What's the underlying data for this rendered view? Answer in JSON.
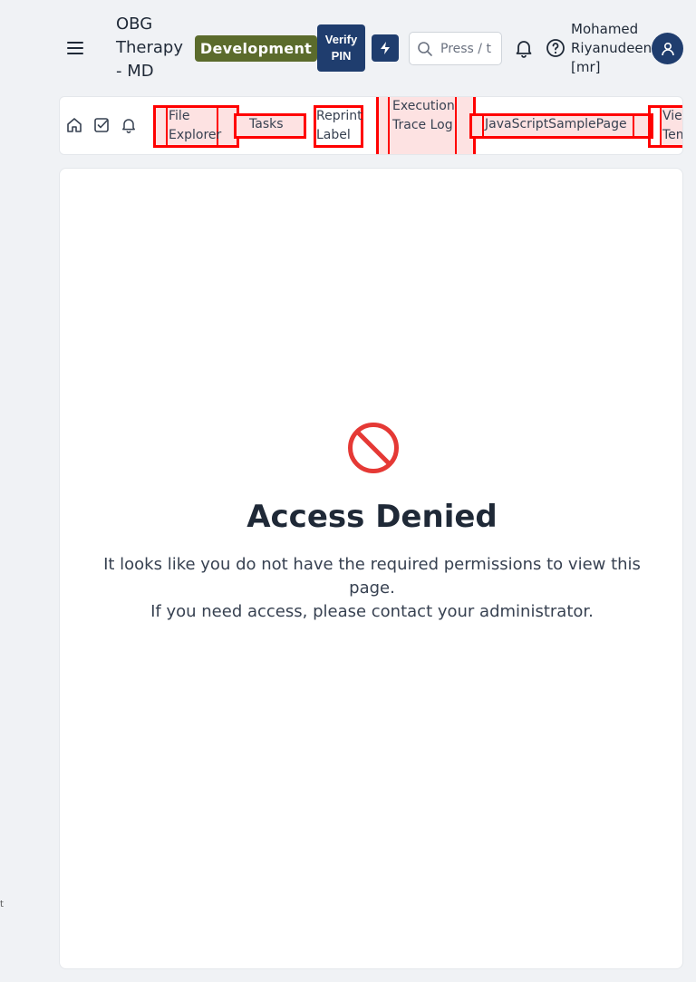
{
  "header": {
    "app_title": "OBG Therapy - MD",
    "environment_badge": "Development",
    "verify_pin_label": "Verify PIN",
    "search_placeholder": "Press / t",
    "user_name": "Mohamed Riyanudeen [mr]",
    "icons": {
      "menu": "hamburger-menu-icon",
      "quick": "lightning-icon",
      "search": "search-icon",
      "notifications": "bell-icon",
      "help": "help-circle-icon",
      "user": "user-icon"
    },
    "colors": {
      "env_badge": "#5b6b2c",
      "primary": "#1f3d6e"
    }
  },
  "tabbar": {
    "icons": [
      "home-icon",
      "check-square-icon",
      "bell-icon"
    ],
    "tabs": [
      {
        "label": "File Explorer"
      },
      {
        "label": "Tasks"
      },
      {
        "label": "Reprint Label"
      },
      {
        "label": "Execution Trace Log"
      },
      {
        "label": "JavaScriptSamplePage"
      },
      {
        "label": "View Tem"
      }
    ],
    "highlight_color": "#ff0000"
  },
  "main": {
    "icon": "prohibited-icon",
    "title": "Access Denied",
    "message_line1": "It looks like you do not have the required permissions to view this page.",
    "message_line2": "If you need access, please contact your administrator."
  },
  "edge_text": "t"
}
